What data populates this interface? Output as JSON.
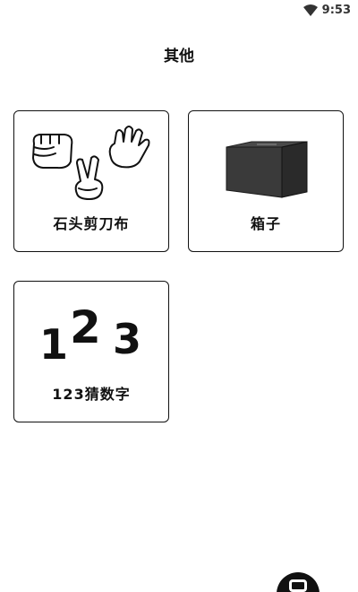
{
  "status_bar": {
    "time": "9:53",
    "wifi_icon": "wifi-icon"
  },
  "header": {
    "title": "其他"
  },
  "games": [
    {
      "label": "石头剪刀布",
      "icon": "rock-paper-scissors-hands-icon"
    },
    {
      "label": "箱子",
      "icon": "cardboard-box-icon"
    },
    {
      "label": "123猜数字",
      "icon": "numbers-123-icon",
      "art_text": [
        "1",
        "2",
        "3"
      ]
    }
  ],
  "floating_button": {
    "icon": "floating-bubble-icon"
  }
}
